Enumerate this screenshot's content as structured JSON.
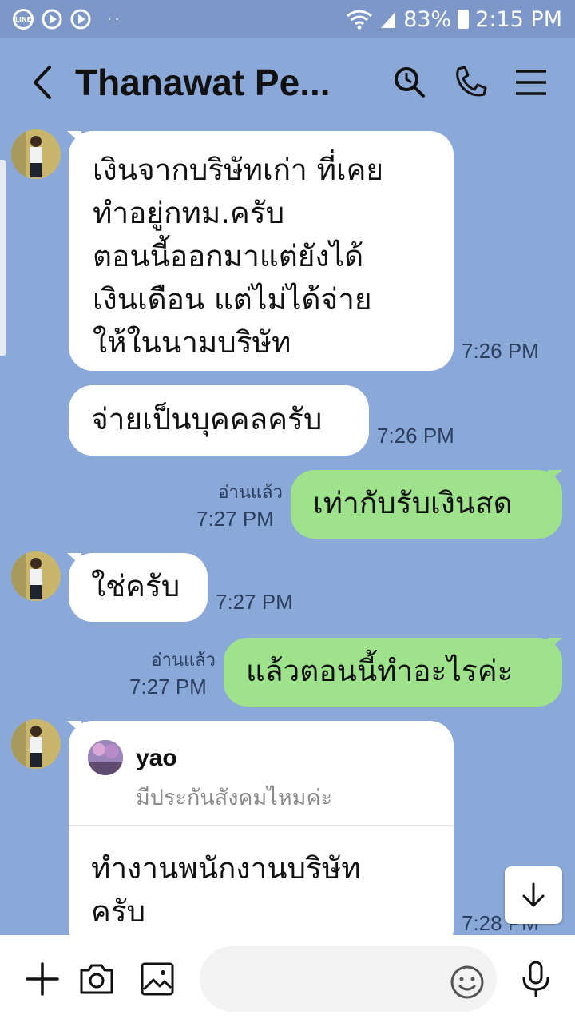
{
  "status_bar": {
    "battery": "83%",
    "time": "2:15 PM",
    "left_dots": "··",
    "app_icons": [
      "line-icon",
      "play-icon",
      "play-icon"
    ]
  },
  "header": {
    "title": "Thanawat Pe...",
    "icons": [
      "back-icon",
      "search-icon",
      "phone-icon",
      "menu-icon"
    ]
  },
  "messages": [
    {
      "side": "received",
      "text": "เงินจากบริษัทเก่า ที่เคย\nทำอยู่กทม.ครับ\nตอนนี้ออกมาแต่ยังได้\nเงินเดือน แต่ไม่ได้จ่าย\nให้ในนามบริษัท",
      "time": "7:26 PM"
    },
    {
      "side": "received",
      "text": "จ่ายเป็นบุคคลครับ",
      "time": "7:26 PM"
    },
    {
      "side": "sent",
      "text": "เท่ากับรับเงินสด",
      "read": "อ่านแล้ว",
      "time": "7:27 PM"
    },
    {
      "side": "received",
      "text": "ใช่ครับ",
      "time": "7:27 PM"
    },
    {
      "side": "sent",
      "text": "แล้วตอนนี้ทำอะไรค่ะ",
      "read": "อ่านแล้ว",
      "time": "7:27 PM"
    },
    {
      "side": "received",
      "reply_to": {
        "name": "yao",
        "quote": "มีประกันสังคมไหมค่ะ"
      },
      "text": "ทำงานพนักงานบริษัท\nครับ",
      "time": "7:28 PM"
    }
  ],
  "input": {
    "placeholder": ""
  },
  "colors": {
    "background": "#8aa9d8",
    "sent_bubble": "#9ee28c",
    "received_bubble": "#ffffff"
  }
}
